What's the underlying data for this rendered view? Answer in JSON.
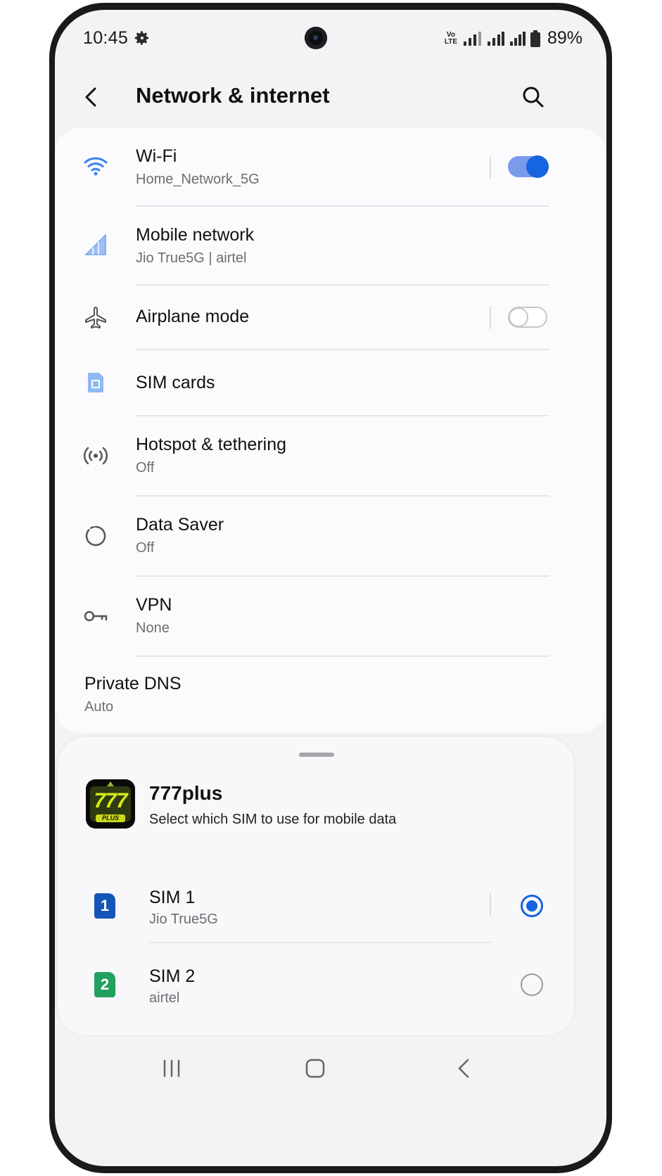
{
  "status_bar": {
    "time": "10:45",
    "volte_top": "Vo",
    "volte_bottom": "LTE",
    "battery_pct": "89%",
    "icons": [
      "gear-icon",
      "volte-icon",
      "signal-icon",
      "signal-icon",
      "signal-icon",
      "battery-icon"
    ]
  },
  "header": {
    "title": "Network & internet",
    "back_icon": "back-arrow-icon",
    "search_icon": "search-icon"
  },
  "settings": {
    "items": [
      {
        "title": "Wi-Fi",
        "subtitle": "Home_Network_5G",
        "icon": "wifi-icon",
        "toggle": true
      },
      {
        "title": "Mobile network",
        "subtitle": "Jio True5G | airtel",
        "icon": "mobile-signal-icon"
      },
      {
        "title": "Airplane mode",
        "icon": "airplane-icon",
        "toggle": false
      },
      {
        "title": "SIM cards",
        "icon": "sim-card-icon"
      },
      {
        "title": "Hotspot & tethering",
        "subtitle": "Off",
        "icon": "hotspot-icon"
      },
      {
        "title": "Data Saver",
        "subtitle": "Off",
        "icon": "data-saver-icon"
      },
      {
        "title": "VPN",
        "subtitle": "None",
        "icon": "key-icon"
      },
      {
        "title": "Private DNS",
        "subtitle": "Auto"
      }
    ]
  },
  "sheet": {
    "app_name": "777plus",
    "app_logo_main": "777",
    "app_logo_sub": "PLUS",
    "description": "Select which SIM to use for mobile data",
    "sims": [
      {
        "badge": "1",
        "title": "SIM 1",
        "subtitle": "Jio True5G",
        "selected": true,
        "color": "#1456b8"
      },
      {
        "badge": "2",
        "title": "SIM 2",
        "subtitle": "airtel",
        "selected": false,
        "color": "#22a060"
      }
    ]
  },
  "nav_bar": {
    "icons": [
      "recents-icon",
      "home-icon",
      "back-icon"
    ]
  },
  "colors": {
    "accent": "#1664e0",
    "wifi_icon": "#3b82f6",
    "screen_bg": "#f3f3f5",
    "card_bg": "#fbfbfd"
  }
}
